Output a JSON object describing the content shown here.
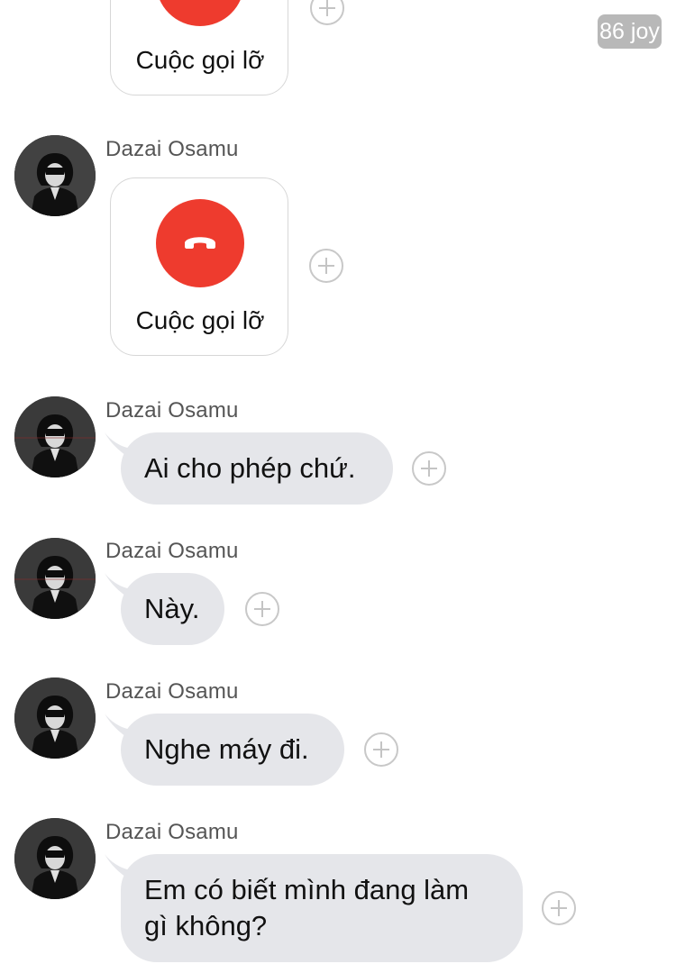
{
  "badge": {
    "text": "86 joy"
  },
  "messages": [
    {
      "type": "call",
      "label": "Cuộc gọi lỡ"
    },
    {
      "type": "call",
      "sender": "Dazai Osamu",
      "label": "Cuộc gọi lỡ"
    },
    {
      "type": "text",
      "sender": "Dazai Osamu",
      "text": "Ai cho phép chứ."
    },
    {
      "type": "text",
      "sender": "Dazai Osamu",
      "text": "Này."
    },
    {
      "type": "text",
      "sender": "Dazai Osamu",
      "text": "Nghe máy đi."
    },
    {
      "type": "text",
      "sender": "Dazai Osamu",
      "lines": [
        "Em có biết mình đang làm",
        "gì không?"
      ]
    }
  ],
  "colors": {
    "bubble": "#e5e6ea",
    "missed_call": "#ee3b2e",
    "sender_text": "#555555"
  },
  "icons": {
    "call": "phone-hangup-icon",
    "add": "plus-circle-icon",
    "avatar": "user-avatar"
  }
}
